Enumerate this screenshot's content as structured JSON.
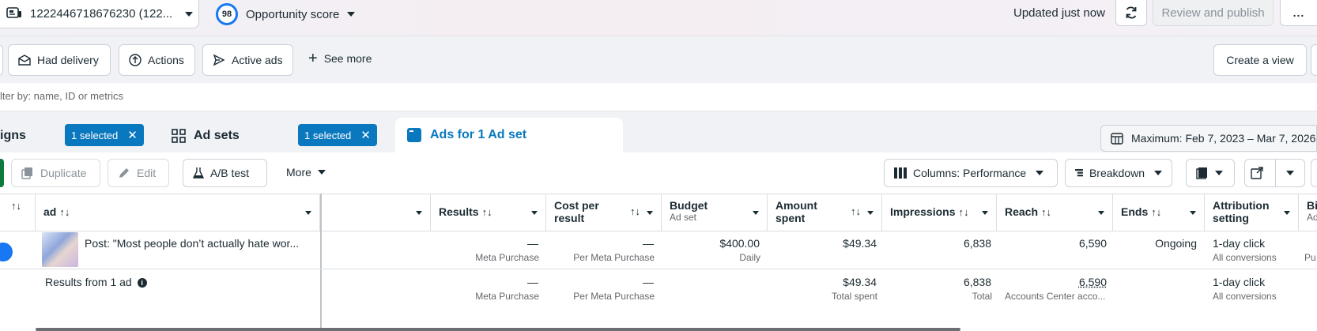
{
  "topbar": {
    "account_label": "1222446718676230 (122...",
    "opportunity_score": "98",
    "opportunity_label": "Opportunity score",
    "updated_text": "Updated just now",
    "review_label": "Review and publish",
    "more_label": "..."
  },
  "filters": {
    "had_delivery": "Had delivery",
    "actions": "Actions",
    "active_ads": "Active ads",
    "see_more": "See more",
    "create_view": "Create a view",
    "search_placeholder": "lter by: name, ID or metrics"
  },
  "tabs": {
    "campaigns_label": "igns",
    "campaigns_chip": "1 selected",
    "adsets_label": "Ad sets",
    "adsets_chip": "1 selected",
    "ads_label": "Ads for 1 Ad set",
    "date_range": "Maximum: Feb 7, 2023 – Mar 7, 2026"
  },
  "toolbar": {
    "duplicate": "Duplicate",
    "edit": "Edit",
    "ab_test": "A/B test",
    "more": "More",
    "columns": "Columns: Performance",
    "breakdown": "Breakdown"
  },
  "table": {
    "headers": {
      "ad": "ad",
      "results": "Results",
      "cost_per_result_1": "Cost per",
      "cost_per_result_2": "result",
      "budget": "Budget",
      "budget_sub": "Ad set",
      "amount_spent_1": "Amount",
      "amount_spent_2": "spent",
      "impressions": "Impressions",
      "reach": "Reach",
      "ends": "Ends",
      "attribution_1": "Attribution",
      "attribution_2": "setting",
      "bid": "Bi",
      "bid_sub": "Ad"
    },
    "row": {
      "ad_name": "Post: \"Most people don’t actually hate wor...",
      "results": "—",
      "results_sub": "Meta Purchase",
      "cost": "—",
      "cost_sub": "Per Meta Purchase",
      "budget": "$400.00",
      "budget_sub": "Daily",
      "spent": "$49.34",
      "impressions": "6,838",
      "reach": "6,590",
      "ends": "Ongoing",
      "attribution": "1-day click",
      "attribution_sub": "All conversions",
      "bid_sub": "Pu"
    },
    "summary": {
      "label": "Results from 1 ad",
      "results": "—",
      "results_sub": "Meta Purchase",
      "cost": "—",
      "cost_sub": "Per Meta Purchase",
      "spent": "$49.34",
      "spent_sub": "Total spent",
      "impressions": "6,838",
      "impressions_sub": "Total",
      "reach": "6,590",
      "reach_sub": "Accounts Center acco...",
      "attribution": "1-day click",
      "attribution_sub": "All conversions"
    },
    "sort_glyph": "↑↓"
  }
}
